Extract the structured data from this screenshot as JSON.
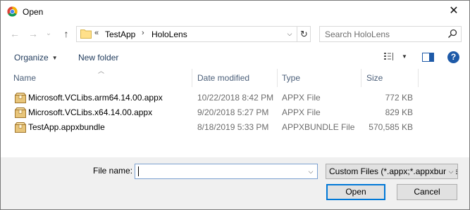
{
  "window": {
    "title": "Open",
    "close_glyph": "✕"
  },
  "nav": {
    "back_glyph": "←",
    "forward_glyph": "→",
    "recent_glyph": "⌄",
    "up_glyph": "↑"
  },
  "address": {
    "overflow": "«",
    "crumbs": [
      "TestApp",
      "HoloLens"
    ],
    "separator": "›",
    "dropdown_glyph": "⌵",
    "refresh_glyph": "↻"
  },
  "search": {
    "placeholder": "Search HoloLens"
  },
  "toolbar": {
    "organize_label": "Organize",
    "new_folder_label": "New folder",
    "help_label": "?"
  },
  "columns": {
    "name": "Name",
    "date": "Date modified",
    "type": "Type",
    "size": "Size"
  },
  "files": [
    {
      "name": "Microsoft.VCLibs.arm64.14.00.appx",
      "date": "10/22/2018 8:42 PM",
      "type": "APPX File",
      "size": "772 KB"
    },
    {
      "name": "Microsoft.VCLibs.x64.14.00.appx",
      "date": "9/20/2018 5:27 PM",
      "type": "APPX File",
      "size": "829 KB"
    },
    {
      "name": "TestApp.appxbundle",
      "date": "8/18/2019 5:33 PM",
      "type": "APPXBUNDLE File",
      "size": "570,585 KB"
    }
  ],
  "footer": {
    "file_name_label": "File name:",
    "file_name_value": "",
    "filter_value": "Custom Files (*.appx;*.appxbundle)",
    "open_label": "Open",
    "cancel_label": "Cancel"
  },
  "colors": {
    "accent": "#0078d7",
    "header_text": "#4c607a",
    "toolbar_text": "#1e395b",
    "folder": "#ffe08a"
  }
}
